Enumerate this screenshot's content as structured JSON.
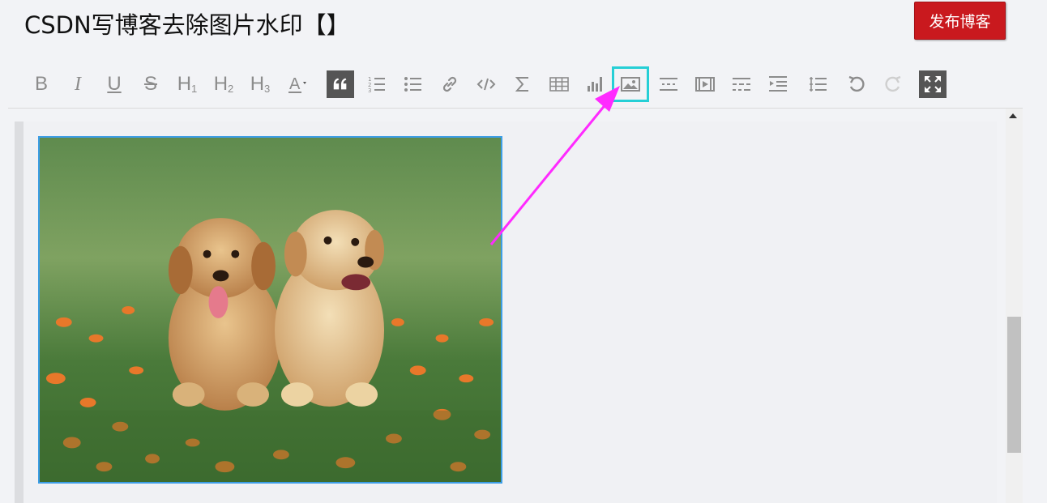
{
  "header": {
    "title": "CSDN写博客去除图片水印【】",
    "publish_label": "发布博客"
  },
  "toolbar": {
    "items": [
      {
        "name": "bold",
        "icon": "bold-icon",
        "glyph": "B"
      },
      {
        "name": "italic",
        "icon": "italic-icon",
        "glyph": "I"
      },
      {
        "name": "underline",
        "icon": "underline-icon",
        "glyph": "U"
      },
      {
        "name": "strikethrough",
        "icon": "strikethrough-icon",
        "glyph": "S"
      },
      {
        "name": "h1",
        "icon": "heading1-icon",
        "glyph": "H",
        "sub": "1"
      },
      {
        "name": "h2",
        "icon": "heading2-icon",
        "glyph": "H",
        "sub": "2"
      },
      {
        "name": "h3",
        "icon": "heading3-icon",
        "glyph": "H",
        "sub": "3"
      },
      {
        "name": "font-color",
        "icon": "font-color-icon",
        "glyph": "A"
      },
      {
        "name": "quote",
        "icon": "quote-icon",
        "glyph": "66"
      },
      {
        "name": "ordered-list",
        "icon": "ordered-list-icon"
      },
      {
        "name": "unordered-list",
        "icon": "unordered-list-icon"
      },
      {
        "name": "link",
        "icon": "link-icon"
      },
      {
        "name": "code",
        "icon": "code-icon",
        "glyph": "</>"
      },
      {
        "name": "formula",
        "icon": "sigma-icon",
        "glyph": "∑"
      },
      {
        "name": "table",
        "icon": "table-icon"
      },
      {
        "name": "chart",
        "icon": "bar-chart-icon"
      },
      {
        "name": "image",
        "icon": "image-icon",
        "selected": true
      },
      {
        "name": "horizontal-rule",
        "icon": "horizontal-rule-icon"
      },
      {
        "name": "video",
        "icon": "video-icon"
      },
      {
        "name": "page-break",
        "icon": "page-break-icon"
      },
      {
        "name": "toc",
        "icon": "table-of-contents-icon"
      },
      {
        "name": "line-numbers",
        "icon": "line-numbers-icon"
      },
      {
        "name": "undo",
        "icon": "undo-icon"
      },
      {
        "name": "redo",
        "icon": "redo-icon"
      },
      {
        "name": "fullscreen",
        "icon": "fullscreen-icon"
      }
    ]
  },
  "editor": {
    "image_alt": "two golden retriever puppies on grass with orange flowers"
  },
  "colors": {
    "publish_bg": "#c9191e",
    "selected_outline": "#26cfd6",
    "annotation_arrow": "#ff2aff",
    "image_border": "#3d9ee6"
  }
}
